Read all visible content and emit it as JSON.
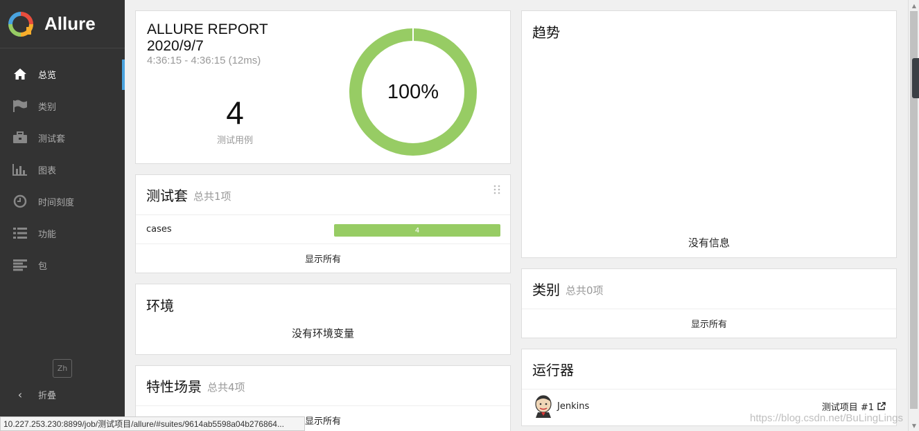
{
  "brand": {
    "name": "Allure"
  },
  "sidebar": {
    "items": [
      {
        "label": "总览",
        "icon": "home-icon",
        "active": true
      },
      {
        "label": "类别",
        "icon": "flag-icon"
      },
      {
        "label": "测试套",
        "icon": "briefcase-icon"
      },
      {
        "label": "图表",
        "icon": "bar-chart-icon"
      },
      {
        "label": "时间刻度",
        "icon": "clock-icon"
      },
      {
        "label": "功能",
        "icon": "list-icon"
      },
      {
        "label": "包",
        "icon": "align-left-icon"
      }
    ],
    "language": "Zh",
    "collapse_label": "折叠"
  },
  "summary": {
    "title": "ALLURE REPORT",
    "date": "2020/9/7",
    "time_range": "4:36:15 - 4:36:15 (12ms)",
    "test_count": "4",
    "test_count_label": "测试用例",
    "pass_rate_text": "100%",
    "pass_fraction": 1.0,
    "colors": {
      "passed": "#97cc64"
    }
  },
  "suites_widget": {
    "title": "测试套",
    "subtitle": "总共1项",
    "rows": [
      {
        "name": "cases",
        "count": "4"
      }
    ],
    "show_all": "显示所有"
  },
  "environment_widget": {
    "title": "环境",
    "empty_text": "没有环境变量"
  },
  "features_widget": {
    "title": "特性场景",
    "subtitle": "总共4项",
    "show_all": "显示所有"
  },
  "trend_widget": {
    "title": "趋势",
    "empty_text": "没有信息"
  },
  "categories_widget": {
    "title": "类别",
    "subtitle": "总共0项",
    "show_all": "显示所有"
  },
  "executors_widget": {
    "title": "运行器",
    "rows": [
      {
        "name": "Jenkins",
        "build": "测试项目 #1"
      }
    ]
  },
  "statusbar": {
    "url": "10.227.253.230:8899/job/测试项目/allure/#suites/9614ab5598a04b276864..."
  },
  "watermark": "https://blog.csdn.net/BuLingLings"
}
